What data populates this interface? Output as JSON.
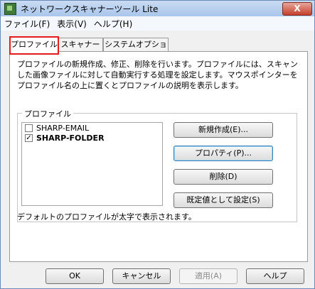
{
  "window": {
    "title": "ネットワークスキャナーツール Lite",
    "close_symbol": "X"
  },
  "menu": [
    "ファイル(F)",
    "表示(V)",
    "ヘルプ(H)"
  ],
  "tabs": [
    "プロファイル",
    "スキャナー",
    "システムオプション"
  ],
  "panel": {
    "description": "プロファイルの新規作成、修正、削除を行います。プロファイルには、スキャンした画像ファイルに対して自動実行する処理を設定します。マウスポインターをプロファイル名の上に置くとプロファイルの説明を表示します。",
    "group_label": "プロファイル",
    "profiles": [
      {
        "name": "SHARP-EMAIL",
        "checked": false,
        "bold": false
      },
      {
        "name": "SHARP-FOLDER",
        "checked": true,
        "bold": true
      }
    ],
    "check_mark": "✓",
    "buttons": {
      "new": "新規作成(E)...",
      "properties": "プロパティ(P)...",
      "delete": "削除(D)",
      "default": "既定値として設定(S)"
    },
    "footer_note": "デフォルトのプロファイルが太字で表示されます。"
  },
  "bottom_buttons": {
    "ok": "OK",
    "cancel": "キャンセル",
    "apply": "適用(A)",
    "help": "ヘルプ"
  }
}
